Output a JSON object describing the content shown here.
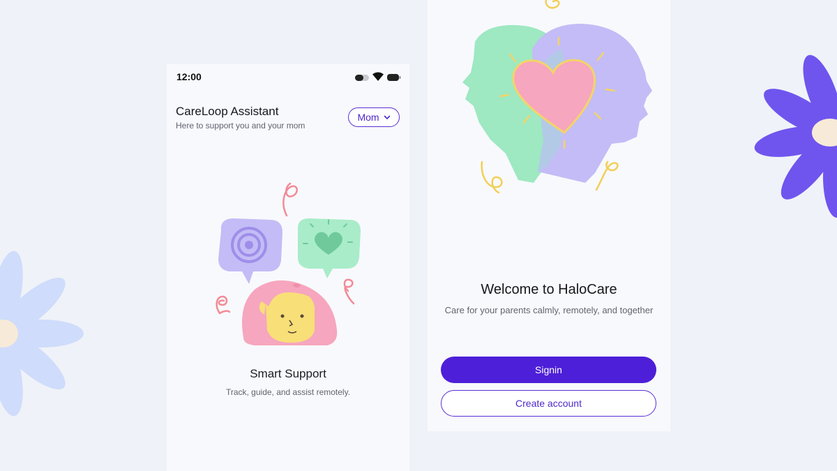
{
  "colors": {
    "background": "#eff2f8",
    "card": "#f8f9fc",
    "accent": "#4d1fd8",
    "flower_purple": "#6f55ee",
    "flower_blue": "#cfdcfb",
    "mint": "#9ee8c2",
    "lavender": "#c3bcf6",
    "pink": "#f6a6be",
    "yellow": "#f6dc7a"
  },
  "left_screen": {
    "status": {
      "time": "12:00",
      "icons": [
        "battery-saver-icon",
        "wifi-icon",
        "battery-icon"
      ]
    },
    "header": {
      "title": "CareLoop Assistant",
      "subtitle": "Here to support you and your mom",
      "profile_select": {
        "value": "Mom",
        "icon": "chevron-down-icon"
      }
    },
    "onboarding": {
      "illustration": "smart-support-illustration",
      "title": "Smart Support",
      "subtitle": "Track, guide, and assist remotely."
    }
  },
  "right_screen": {
    "illustration": "heart-heads-illustration",
    "title": "Welcome to HaloCare",
    "subtitle": "Care for your parents calmly, remotely, and together",
    "primary_button": "Signin",
    "secondary_button": "Create account"
  }
}
